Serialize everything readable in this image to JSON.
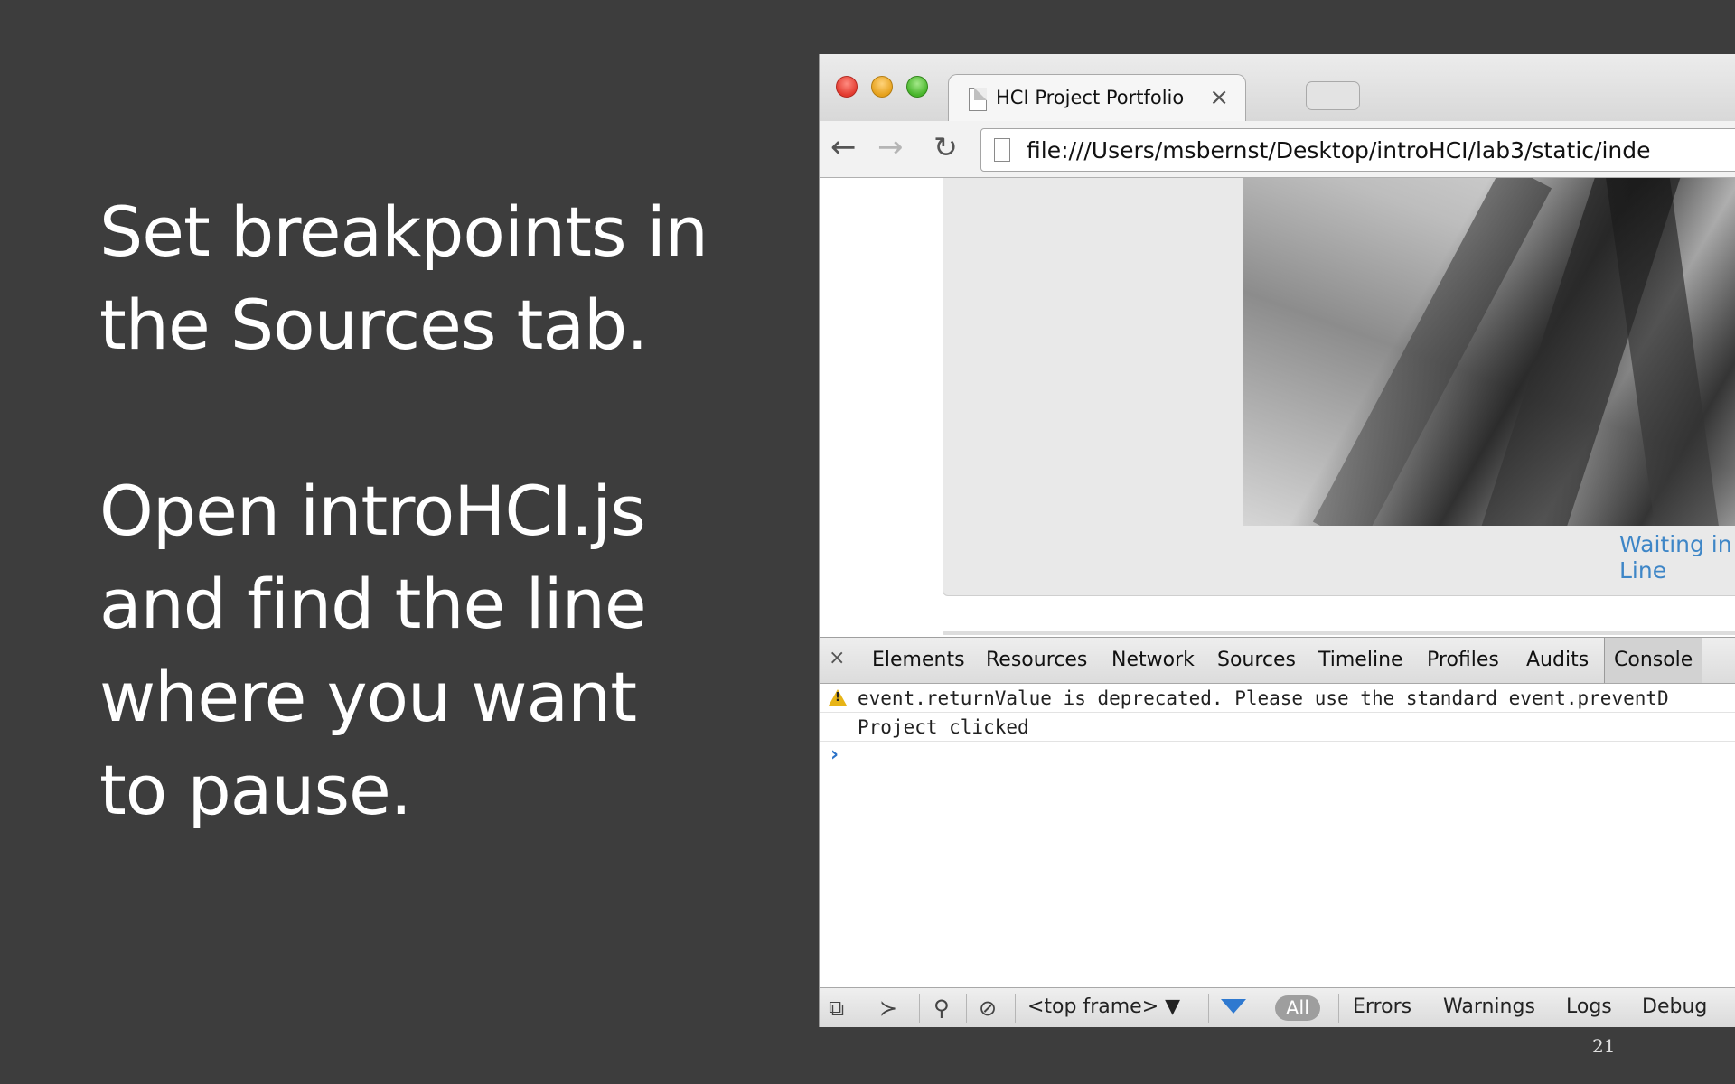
{
  "slide": {
    "paragraph1": [
      "Set breakpoints in",
      "the Sources tab."
    ],
    "paragraph2": [
      "Open introHCI.js",
      "and find the line",
      "where you want",
      "to pause."
    ],
    "page_number": "21"
  },
  "browser": {
    "tab_title": "HCI Project Portfolio",
    "tab_close": "×",
    "url": "file:///Users/msbernst/Desktop/introHCI/lab3/static/inde",
    "nav": {
      "back": "←",
      "forward": "→",
      "reload": "↻"
    }
  },
  "page": {
    "caption": "Waiting in Line"
  },
  "devtools": {
    "close": "×",
    "tabs": [
      "Elements",
      "Resources",
      "Network",
      "Sources",
      "Timeline",
      "Profiles",
      "Audits",
      "Console"
    ],
    "active_tab": "Console",
    "console_lines": [
      {
        "level": "warning",
        "text": "event.returnValue is deprecated. Please use the standard event.preventD"
      },
      {
        "level": "log",
        "text": "Project clicked"
      }
    ],
    "prompt": "›",
    "bottom": {
      "frame_select": "<top frame> ▼",
      "filter_all": "All",
      "levels": [
        "Errors",
        "Warnings",
        "Logs",
        "Debug"
      ]
    }
  },
  "colors": {
    "slide_background": "#3d3d3d",
    "caption_link": "#3e86c7",
    "warning": "#e7b416",
    "prompt": "#2c73c8"
  }
}
